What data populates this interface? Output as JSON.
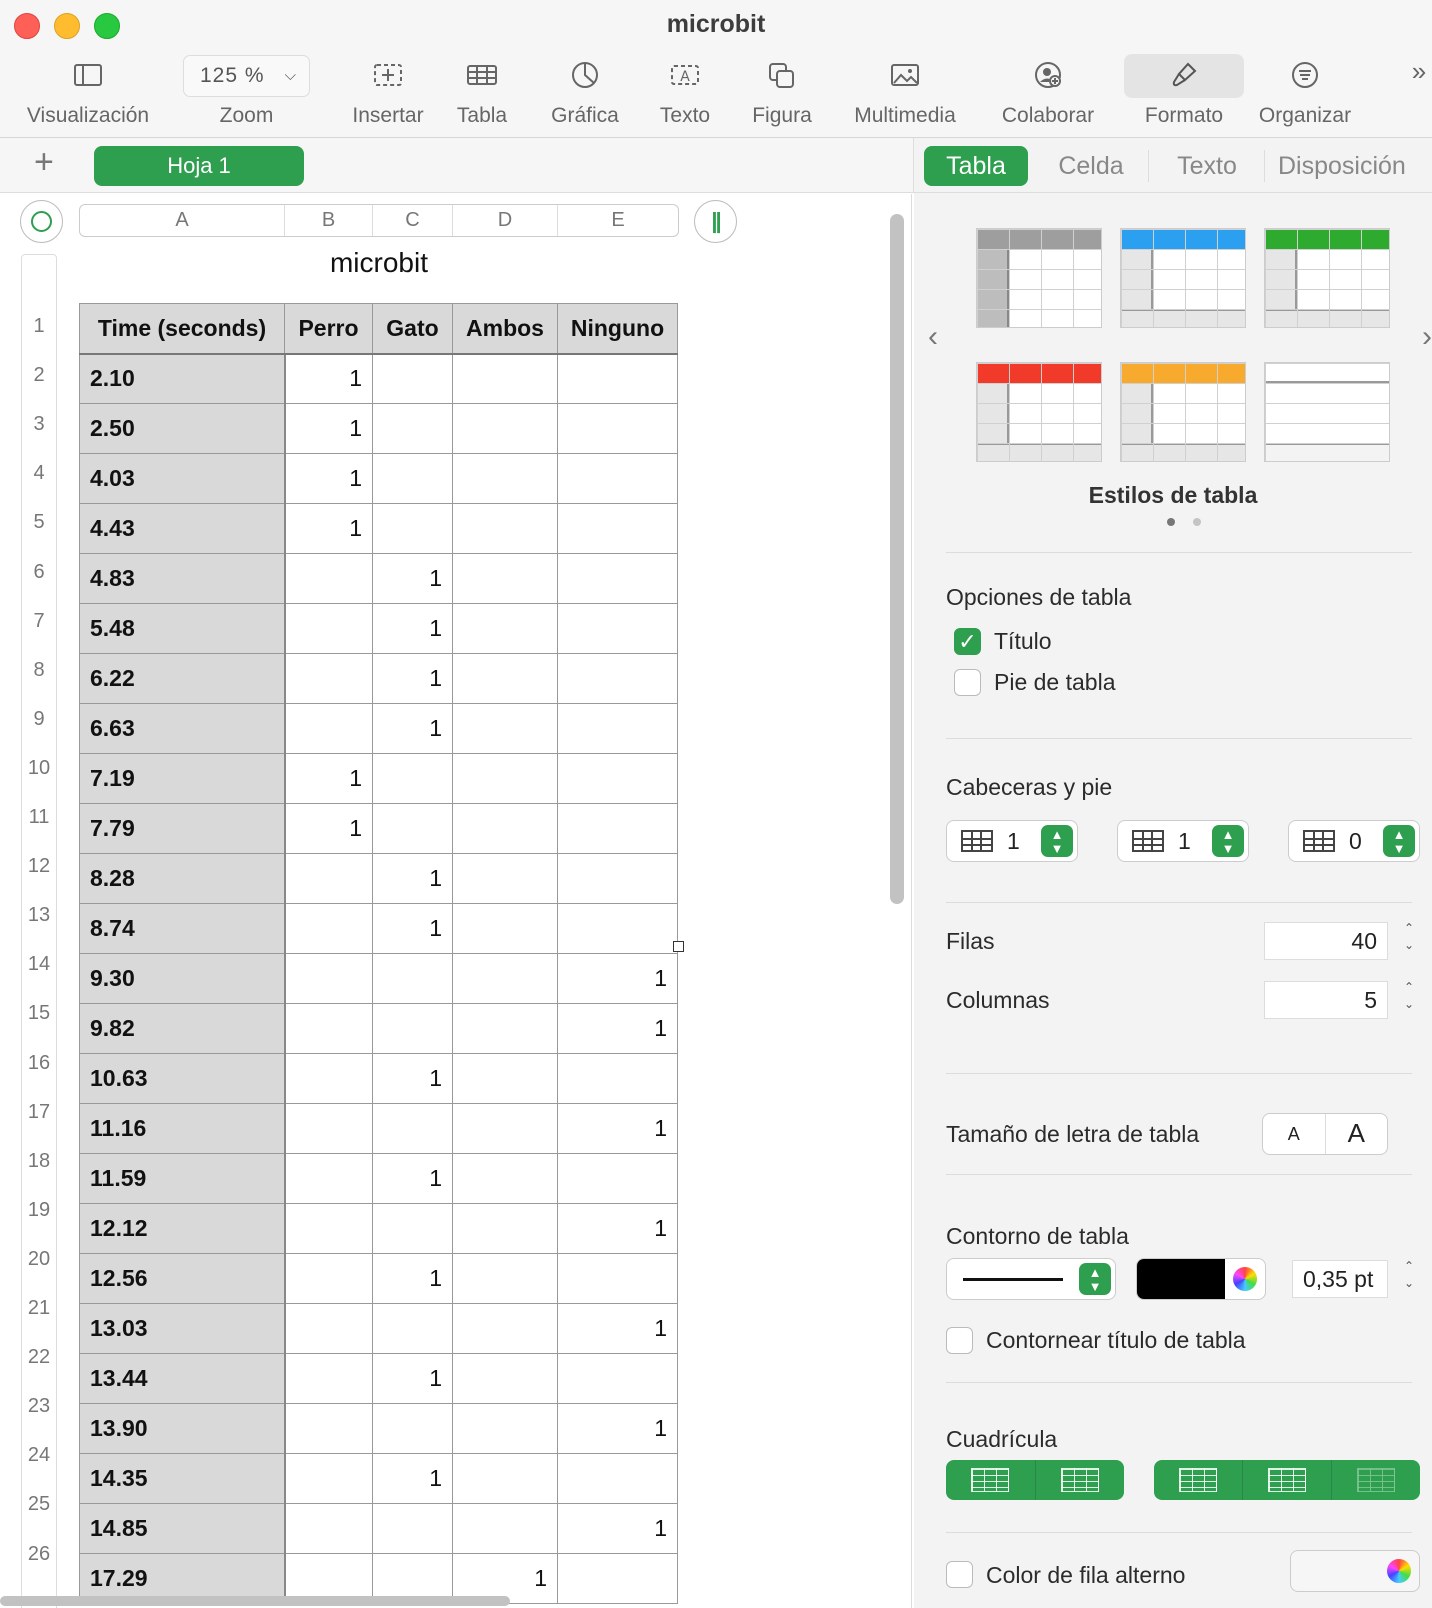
{
  "window": {
    "title": "microbit"
  },
  "toolbar": {
    "view_label": "Visualización",
    "zoom_value": "125 %",
    "zoom_label": "Zoom",
    "insert_label": "Insertar",
    "table_label": "Tabla",
    "chart_label": "Gráfica",
    "text_label": "Texto",
    "shape_label": "Figura",
    "media_label": "Multimedia",
    "collaborate_label": "Colaborar",
    "format_label": "Formato",
    "organize_label": "Organizar",
    "more_label": "»"
  },
  "sheets": {
    "add_label": "+",
    "active": "Hoja 1"
  },
  "grid": {
    "columns": [
      "A",
      "B",
      "C",
      "D",
      "E"
    ],
    "freeze_label": "||"
  },
  "table": {
    "title": "microbit",
    "headers": [
      "Time (seconds)",
      "Perro",
      "Gato",
      "Ambos",
      "Ninguno"
    ],
    "rows": [
      [
        "2.10",
        "1",
        "",
        "",
        ""
      ],
      [
        "2.50",
        "1",
        "",
        "",
        ""
      ],
      [
        "4.03",
        "1",
        "",
        "",
        ""
      ],
      [
        "4.43",
        "1",
        "",
        "",
        ""
      ],
      [
        "4.83",
        "",
        "1",
        "",
        ""
      ],
      [
        "5.48",
        "",
        "1",
        "",
        ""
      ],
      [
        "6.22",
        "",
        "1",
        "",
        ""
      ],
      [
        "6.63",
        "",
        "1",
        "",
        ""
      ],
      [
        "7.19",
        "1",
        "",
        "",
        ""
      ],
      [
        "7.79",
        "1",
        "",
        "",
        ""
      ],
      [
        "8.28",
        "",
        "1",
        "",
        ""
      ],
      [
        "8.74",
        "",
        "1",
        "",
        ""
      ],
      [
        "9.30",
        "",
        "",
        "",
        "1"
      ],
      [
        "9.82",
        "",
        "",
        "",
        "1"
      ],
      [
        "10.63",
        "",
        "1",
        "",
        ""
      ],
      [
        "11.16",
        "",
        "",
        "",
        "1"
      ],
      [
        "11.59",
        "",
        "1",
        "",
        ""
      ],
      [
        "12.12",
        "",
        "",
        "",
        "1"
      ],
      [
        "12.56",
        "",
        "1",
        "",
        ""
      ],
      [
        "13.03",
        "",
        "",
        "",
        "1"
      ],
      [
        "13.44",
        "",
        "1",
        "",
        ""
      ],
      [
        "13.90",
        "",
        "",
        "",
        "1"
      ],
      [
        "14.35",
        "",
        "1",
        "",
        ""
      ],
      [
        "14.85",
        "",
        "",
        "",
        "1"
      ],
      [
        "17.29",
        "",
        "",
        "1",
        ""
      ]
    ],
    "row_numbers": [
      "1",
      "2",
      "3",
      "4",
      "5",
      "6",
      "7",
      "8",
      "9",
      "10",
      "11",
      "12",
      "13",
      "14",
      "15",
      "16",
      "17",
      "18",
      "19",
      "20",
      "21",
      "22",
      "23",
      "24",
      "25",
      "26"
    ]
  },
  "inspector": {
    "tabs": [
      "Tabla",
      "Celda",
      "Texto",
      "Disposición"
    ],
    "styles_label": "Estilos de tabla",
    "style_colors": [
      "#9e9e9e",
      "#2ba0f0",
      "#2eaa2e",
      "#f23a2a",
      "#f7aa2e",
      "#ffffff"
    ],
    "options_title": "Opciones de tabla",
    "title_checkbox_label": "Título",
    "title_checked": true,
    "footer_checkbox_label": "Pie de tabla",
    "footer_checked": false,
    "headers_title": "Cabeceras y pie",
    "header_rows": "1",
    "header_cols": "1",
    "footer_rows": "0",
    "rows_label": "Filas",
    "rows_value": "40",
    "cols_label": "Columnas",
    "cols_value": "5",
    "font_size_label": "Tamaño de letra de tabla",
    "font_small": "A",
    "font_large": "A",
    "outline_title": "Contorno de tabla",
    "outline_color": "#000000",
    "outline_width": "0,35 pt",
    "outline_title_checkbox": "Contornear título de tabla",
    "gridlines_title": "Cuadrícula",
    "alt_row_label": "Color de fila alterno",
    "accent_color": "#2e9e4f"
  }
}
